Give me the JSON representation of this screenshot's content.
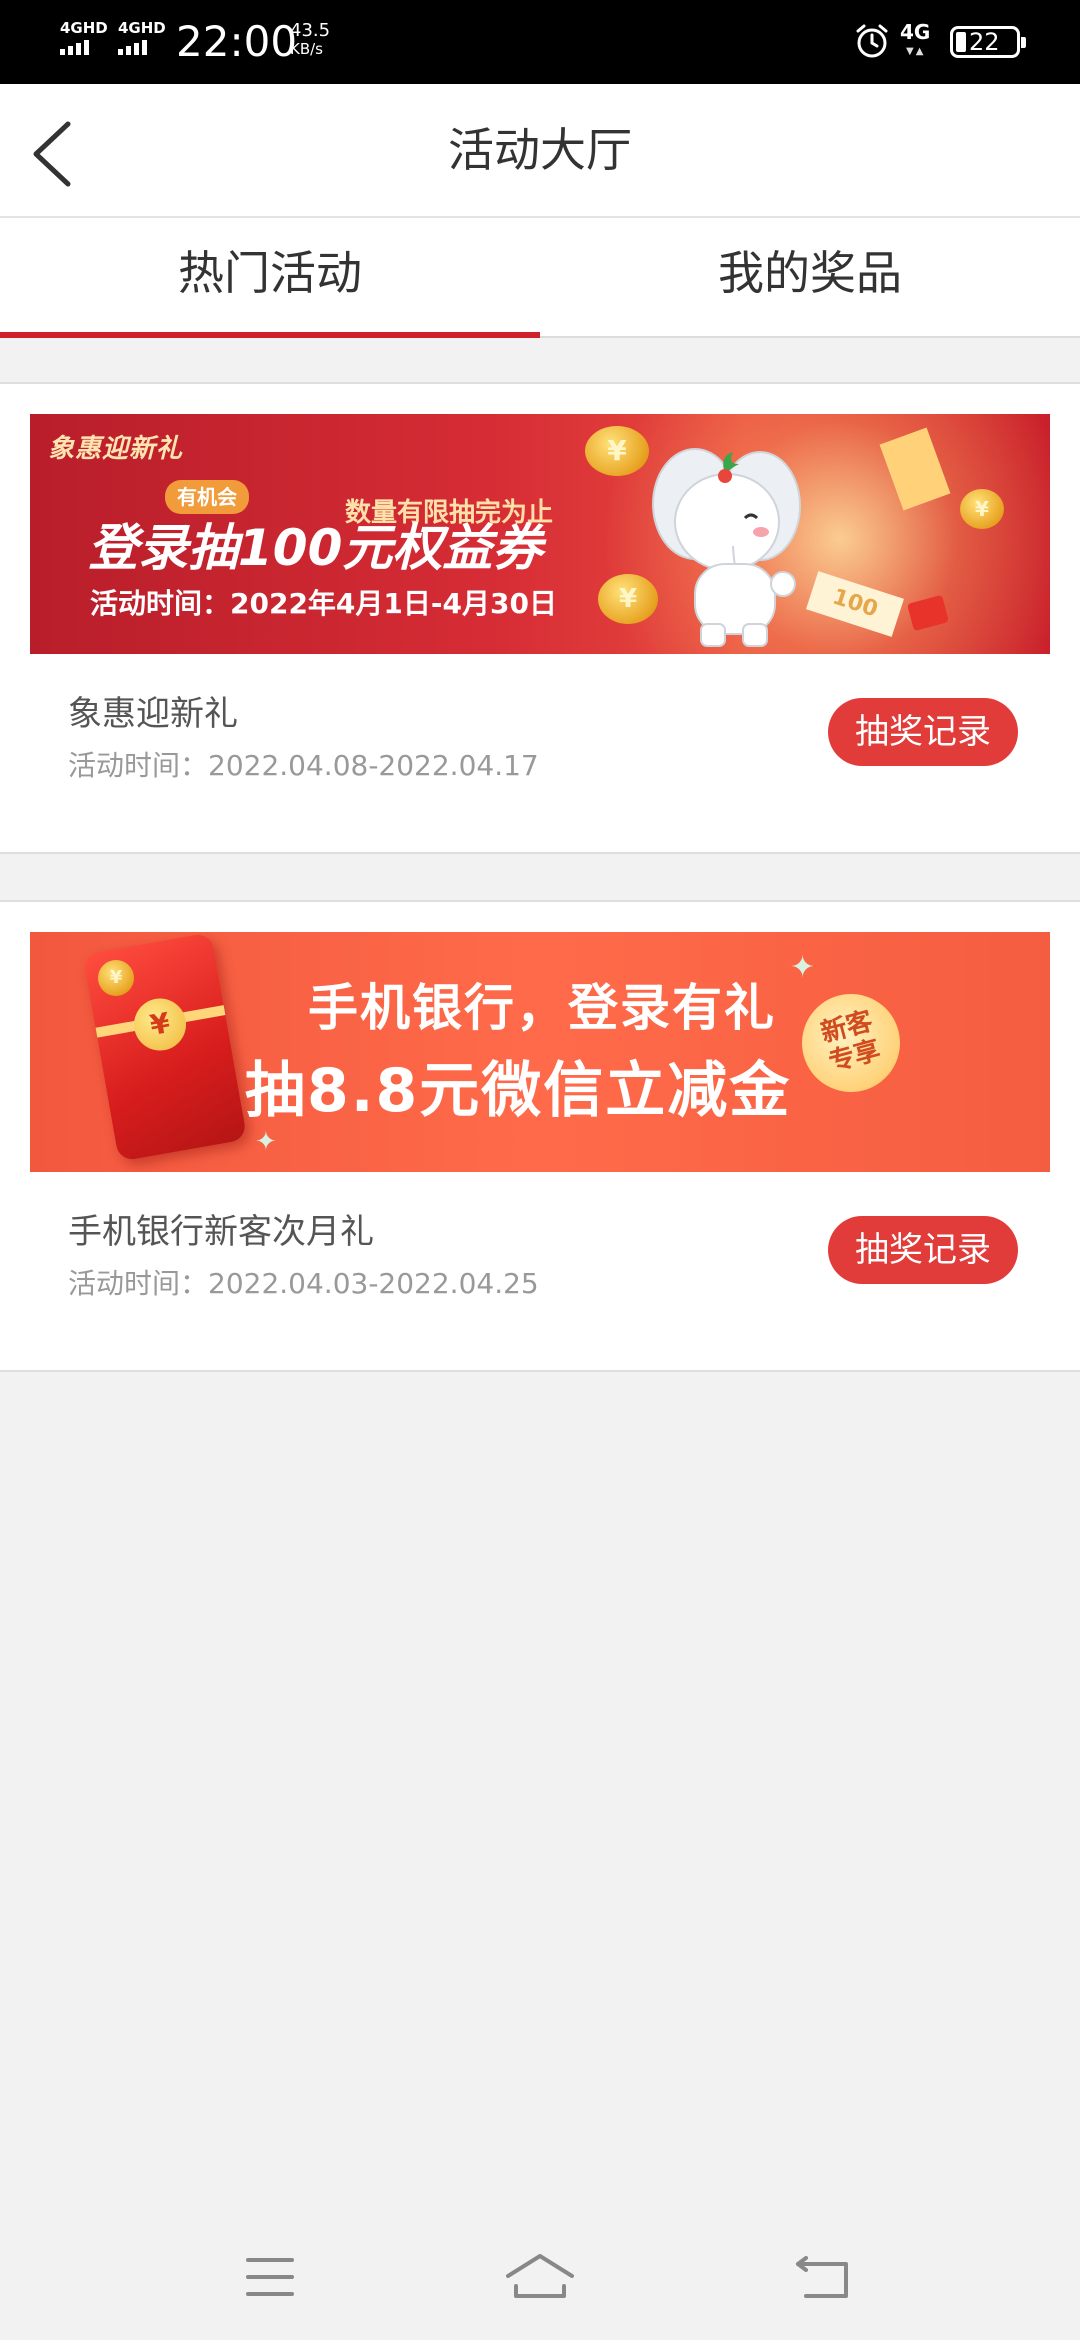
{
  "status_bar": {
    "signal1": "4GHD",
    "signal2": "4GHD",
    "time": "22:00",
    "speed_value": "43.5",
    "speed_unit": "KB/s",
    "network": "4G",
    "battery": "22",
    "icons": [
      "signal-icon",
      "alarm-icon",
      "battery-icon"
    ]
  },
  "header": {
    "title": "活动大厅",
    "back_icon": "chevron-left-icon"
  },
  "tabs": [
    {
      "label": "热门活动",
      "active": true
    },
    {
      "label": "我的奖品",
      "active": false
    }
  ],
  "activities": [
    {
      "banner": {
        "brand": "象惠迎新礼",
        "chance": "有机会",
        "limit": "数量有限抽完为止",
        "headline": "登录抽100元权益券",
        "dates": "活动时间：2022年4月1日-4月30日"
      },
      "name": "象惠迎新礼",
      "time": "活动时间：2022.04.08-2022.04.17",
      "button": "抽奖记录"
    },
    {
      "banner": {
        "line1": "手机银行，登录有礼",
        "line2": "抽8.8元微信立减金",
        "badge_line1": "新客",
        "badge_line2": "专享",
        "seal": "¥"
      },
      "name": "手机银行新客次月礼",
      "time": "活动时间：2022.04.03-2022.04.25",
      "button": "抽奖记录"
    }
  ],
  "colors": {
    "accent": "#d0202a",
    "button": "#e13b3a",
    "background": "#f2f2f2"
  },
  "nav_bar": {
    "icons": [
      "menu-icon",
      "home-icon",
      "back-icon"
    ]
  }
}
